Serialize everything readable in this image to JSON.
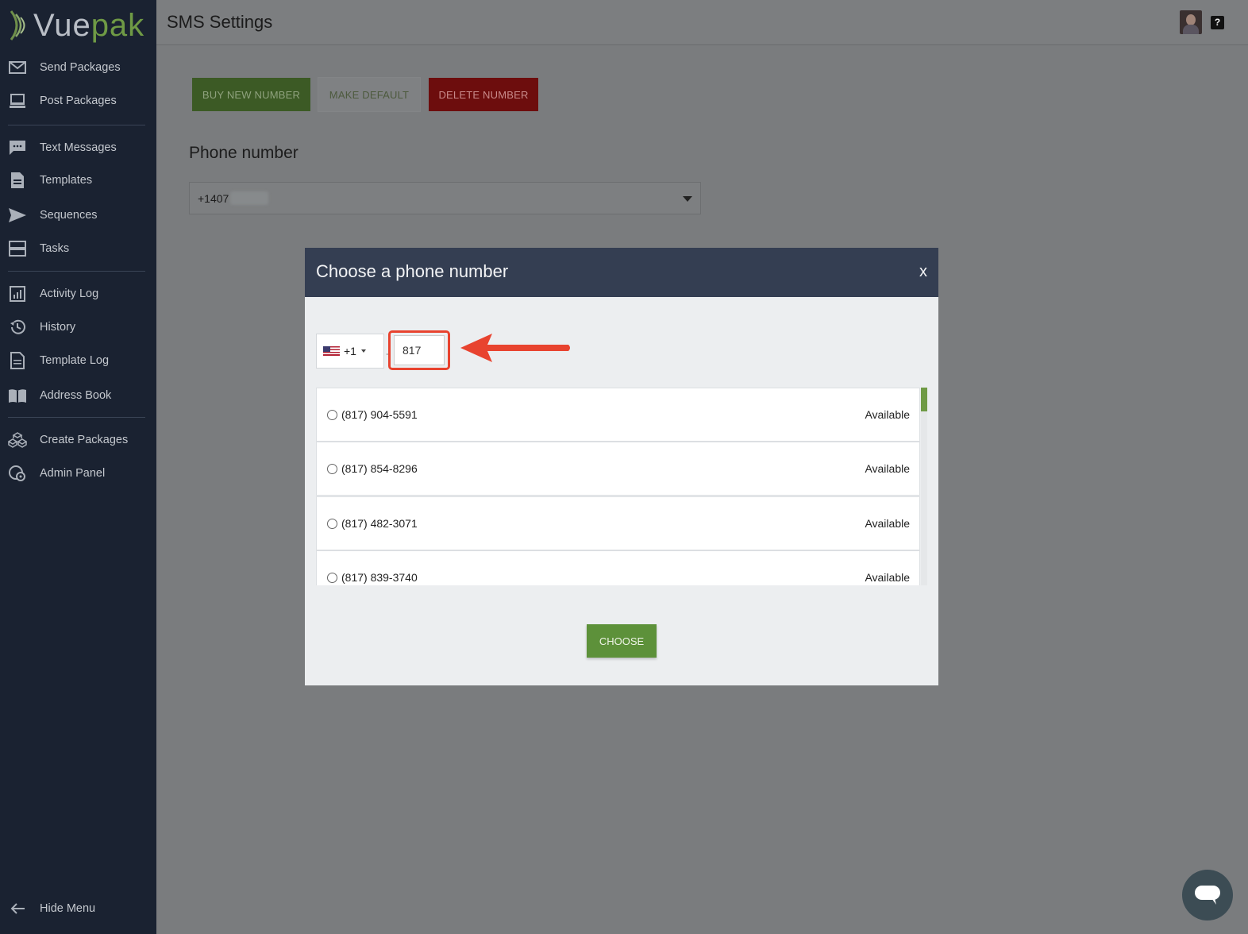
{
  "sidebar": {
    "logo": {
      "part1": "Vue",
      "part2": "pak"
    },
    "items": [
      {
        "label": "Send Packages",
        "icon": "mail-icon"
      },
      {
        "label": "Post Packages",
        "icon": "monitor-icon"
      },
      {
        "label": "Text Messages",
        "icon": "chat-icon"
      },
      {
        "label": "Templates",
        "icon": "document-icon"
      },
      {
        "label": "Sequences",
        "icon": "send-icon"
      },
      {
        "label": "Tasks",
        "icon": "tasks-icon"
      },
      {
        "label": "Activity Log",
        "icon": "chart-icon"
      },
      {
        "label": "History",
        "icon": "history-icon"
      },
      {
        "label": "Template Log",
        "icon": "file-icon"
      },
      {
        "label": "Address Book",
        "icon": "book-icon"
      },
      {
        "label": "Create Packages",
        "icon": "cubes-icon"
      },
      {
        "label": "Admin Panel",
        "icon": "admin-icon"
      }
    ],
    "hide_menu": "Hide Menu"
  },
  "header": {
    "title": "SMS Settings"
  },
  "toolbar": {
    "buy_label": "BUY NEW NUMBER",
    "default_label": "MAKE DEFAULT",
    "delete_label": "DELETE NUMBER"
  },
  "phone": {
    "label": "Phone number",
    "value": "+1407"
  },
  "modal": {
    "title": "Choose a phone number",
    "close": "x",
    "country_code": "+1",
    "search_value": "817",
    "numbers": [
      {
        "number": "(817) 904-5591",
        "status": "Available"
      },
      {
        "number": "(817) 854-8296",
        "status": "Available"
      },
      {
        "number": "(817) 482-3071",
        "status": "Available"
      },
      {
        "number": "(817) 839-3740",
        "status": "Available"
      }
    ],
    "choose_label": "CHOOSE"
  },
  "colors": {
    "accent": "#6f9a45",
    "sidebar": "#1a2231",
    "modal_header": "#343e52",
    "highlight": "#e8432f"
  }
}
